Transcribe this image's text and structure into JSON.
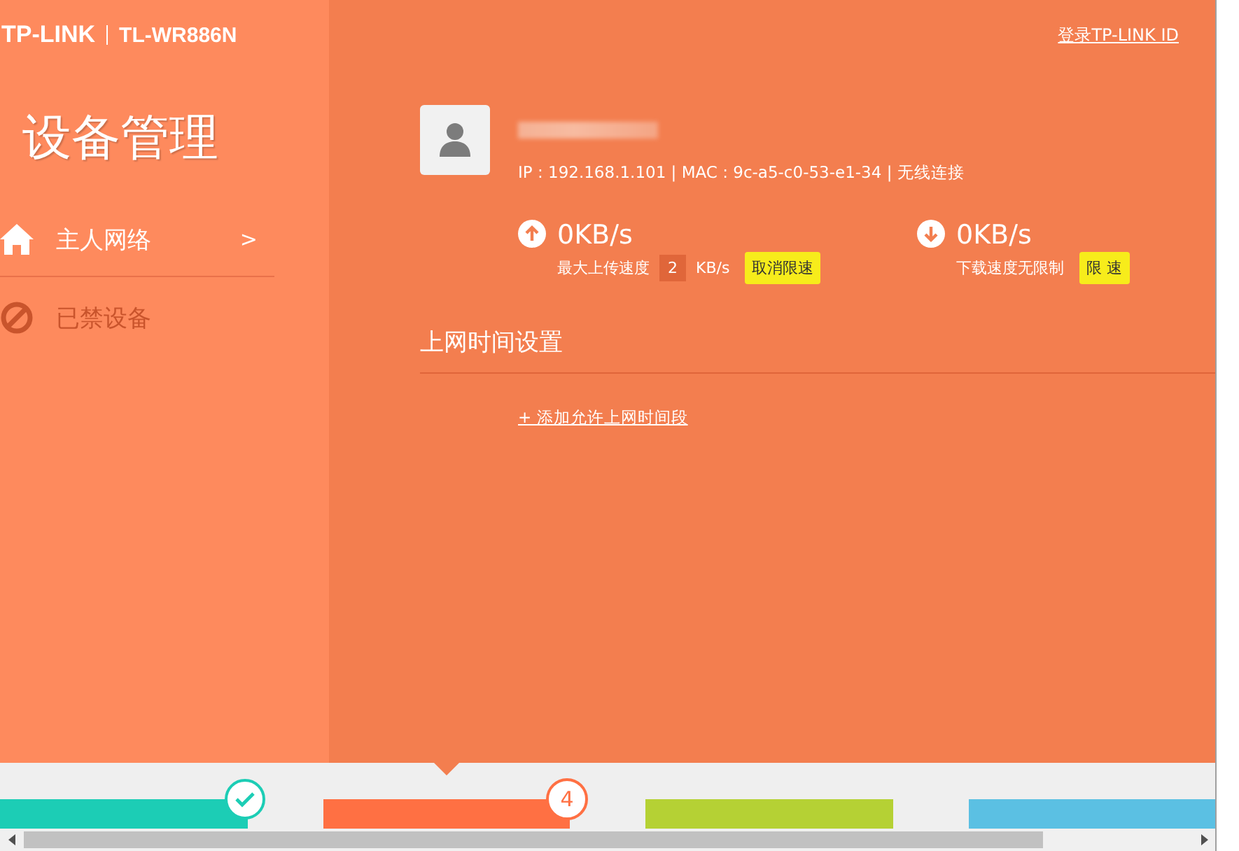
{
  "header": {
    "logo": "TP-LINK",
    "model": "TL-WR886N",
    "links": [
      "登录TP-LINK ID"
    ]
  },
  "sidebar": {
    "title": "设备管理",
    "items": [
      {
        "label": "主人网络",
        "kind": "home",
        "selected": true,
        "arrow": ">"
      },
      {
        "label": "已禁设备",
        "kind": "blocked",
        "selected": false
      }
    ]
  },
  "device": {
    "info": "IP : 192.168.1.101 | MAC : 9c-a5-c0-53-e1-34 | 无线连接"
  },
  "upload": {
    "speed": "0KB/s",
    "label": "最大上传速度",
    "limit": "2",
    "unit": "KB/s",
    "button": "取消限速"
  },
  "download": {
    "speed": "0KB/s",
    "label": "下载速度无限制",
    "button": "限 速"
  },
  "schedule": {
    "title": "上网时间设置",
    "add_link": "+ 添加允许上网时间段"
  },
  "steps": [
    {
      "kind": "done",
      "color": "#1ccdb5",
      "selected": false
    },
    {
      "kind": "number",
      "badge": "4",
      "color": "#ff7043",
      "selected": true
    },
    {
      "kind": "plain",
      "color": "#b5d134",
      "selected": false
    },
    {
      "kind": "plain",
      "color": "#5bc0e3",
      "selected": false
    }
  ]
}
